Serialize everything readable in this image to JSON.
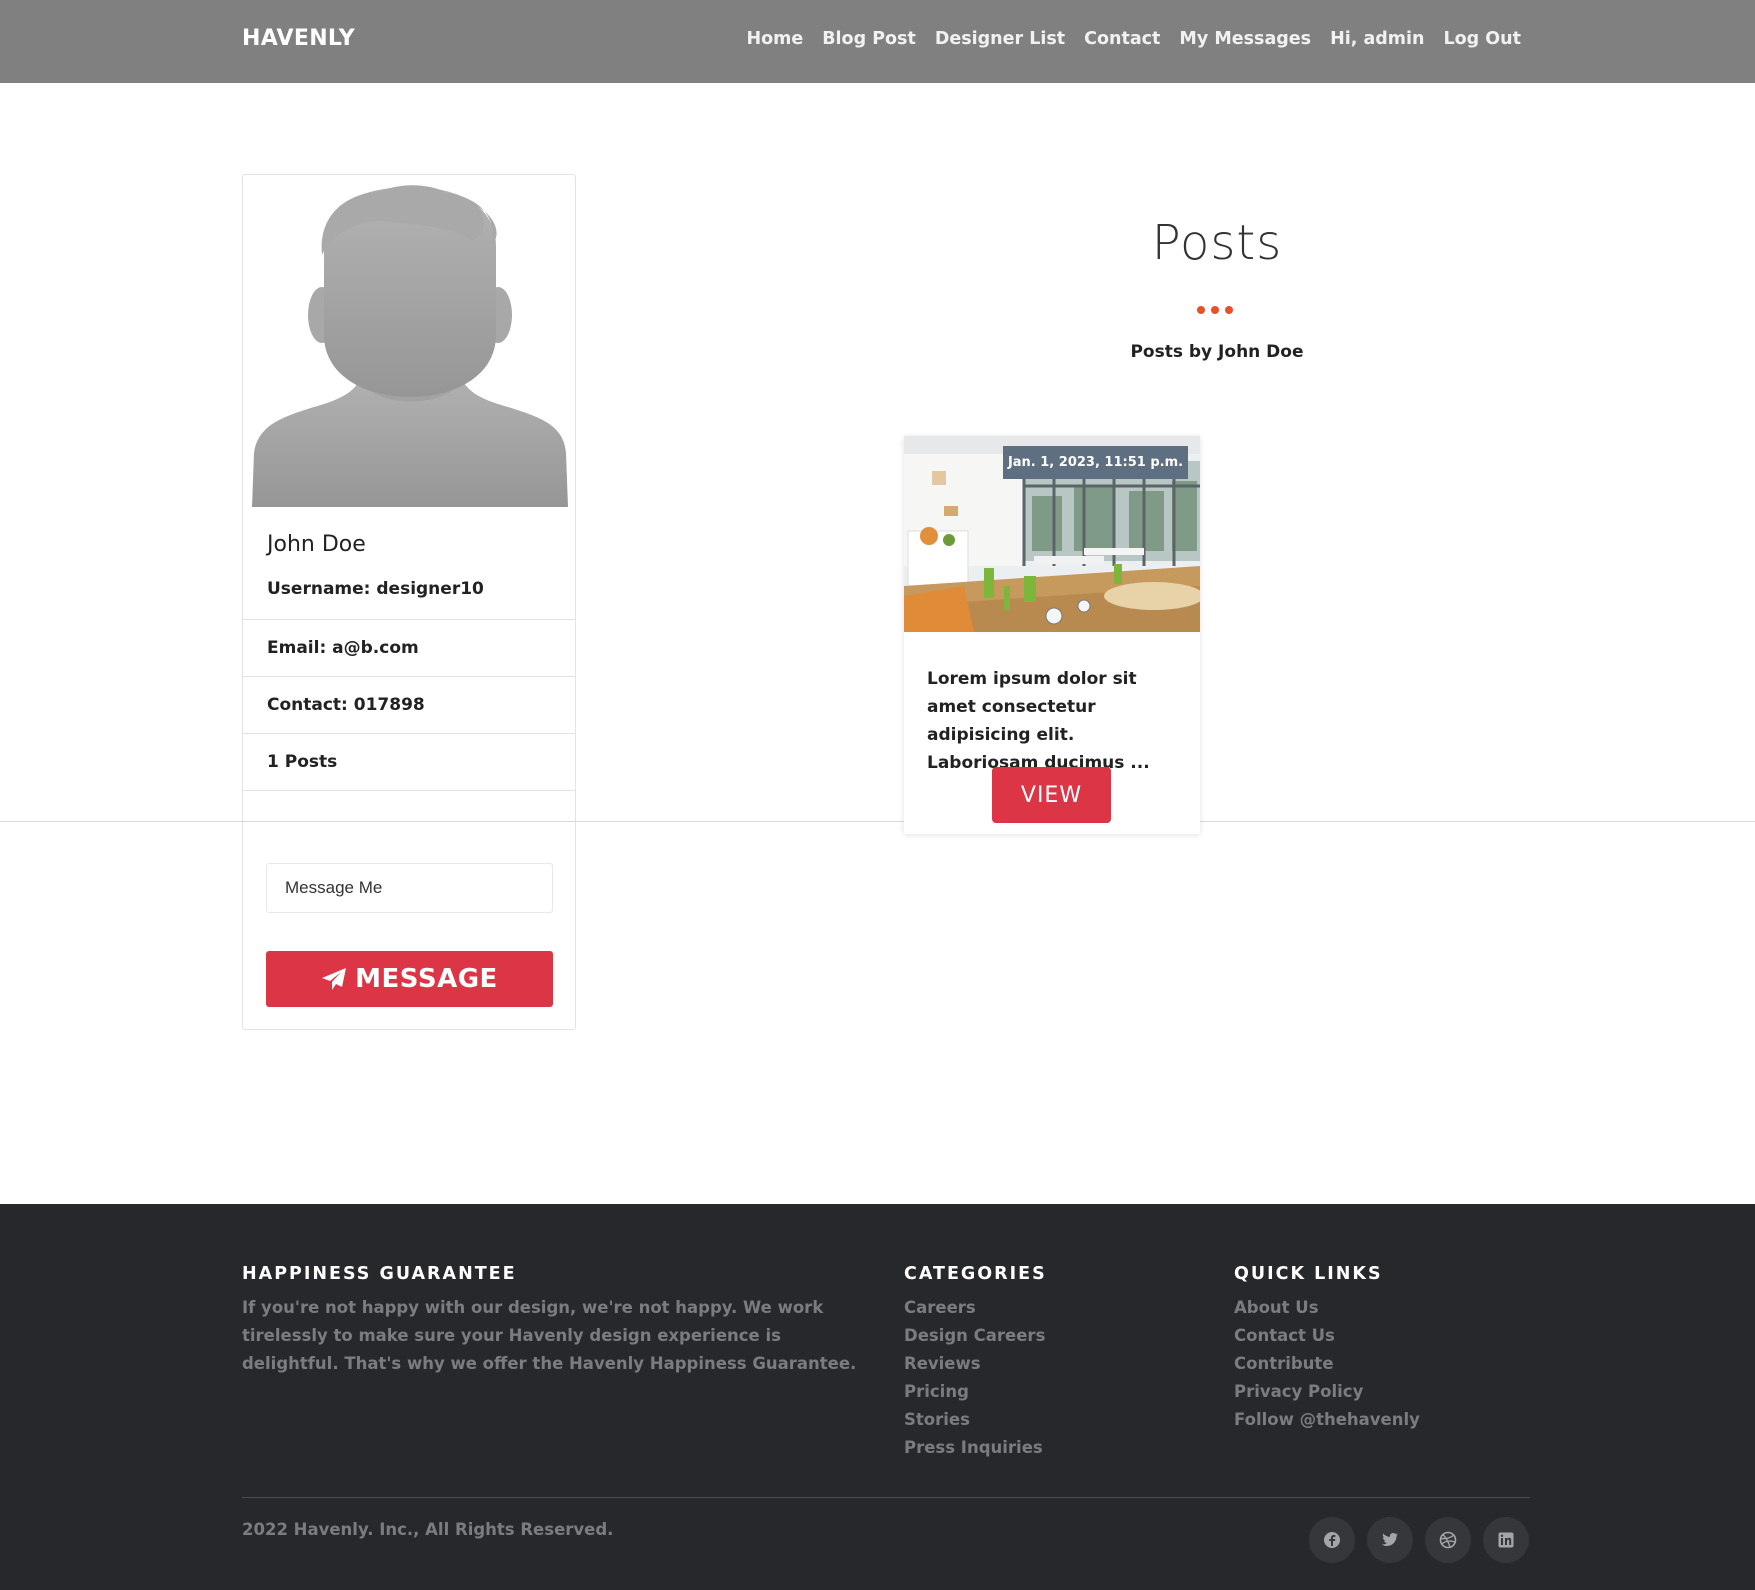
{
  "navbar": {
    "brand": "HAVENLY",
    "links": [
      "Home",
      "Blog Post",
      "Designer List",
      "Contact",
      "My Messages",
      "Hi, admin",
      "Log Out"
    ]
  },
  "profile": {
    "name": "John Doe",
    "username": "Username: designer10",
    "email": "Email: a@b.com",
    "contact": "Contact: 017898",
    "posts_count": "1 Posts",
    "message_placeholder": "Message Me",
    "message_button": "MESSAGE",
    "message_icon": "paper-plane-icon"
  },
  "posts": {
    "title": "Posts",
    "subtitle": "Posts by John Doe",
    "accent_color": "#e8502a",
    "items": [
      {
        "date": "Jan. 1, 2023, 11:51 p.m.",
        "excerpt": "Lorem ipsum dolor sit amet consectetur adipisicing elit. Laboriosam ducimus ...",
        "button": "VIEW"
      }
    ]
  },
  "footer": {
    "guarantee": {
      "title": "HAPPINESS GUARANTEE",
      "text": "If you're not happy with our design, we're not happy. We work tirelessly to make sure your Havenly design experience is delightful. That's why we offer the Havenly Happiness Guarantee."
    },
    "categories": {
      "title": "CATEGORIES",
      "links": [
        "Careers",
        "Design Careers",
        "Reviews",
        "Pricing",
        "Stories",
        "Press Inquiries"
      ]
    },
    "quick_links": {
      "title": "QUICK LINKS",
      "links": [
        "About Us",
        "Contact Us",
        "Contribute",
        "Privacy Policy",
        "Follow @thehavenly"
      ]
    },
    "copyright": "2022 Havenly. Inc., All Rights Reserved.",
    "socials": [
      "facebook-icon",
      "twitter-icon",
      "dribbble-icon",
      "linkedin-icon"
    ]
  },
  "colors": {
    "navbar": "#808080",
    "primary_button": "#dc3545",
    "footer_bg": "#27282b",
    "date_badge": "#5d6f80"
  }
}
